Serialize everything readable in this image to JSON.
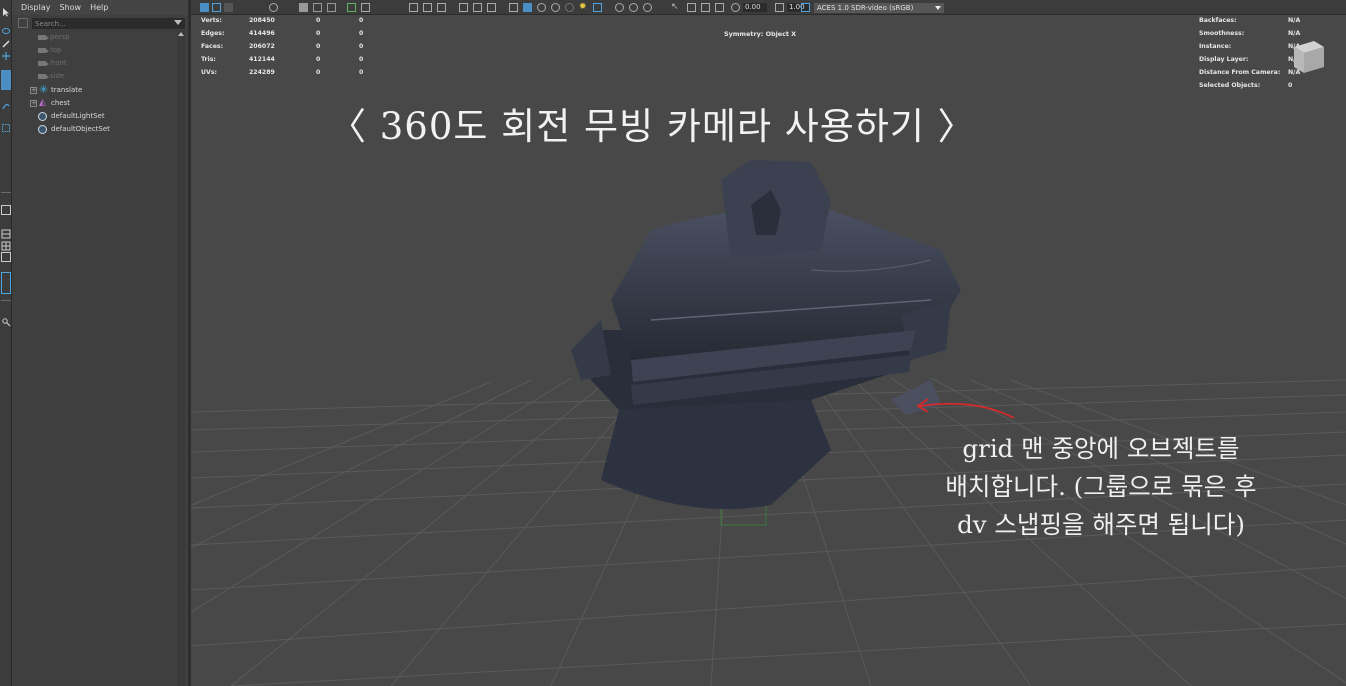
{
  "outliner": {
    "menu": [
      "Display",
      "Show",
      "Help"
    ],
    "search_placeholder": "Search...",
    "items": [
      {
        "label": "persp",
        "type": "camera",
        "dim": true
      },
      {
        "label": "top",
        "type": "camera",
        "dim": true
      },
      {
        "label": "front",
        "type": "camera",
        "dim": true
      },
      {
        "label": "side",
        "type": "camera",
        "dim": true
      },
      {
        "label": "translate",
        "type": "locator",
        "dim": false
      },
      {
        "label": "chest",
        "type": "mesh",
        "dim": false
      },
      {
        "label": "defaultLightSet",
        "type": "set",
        "dim": false
      },
      {
        "label": "defaultObjectSet",
        "type": "set",
        "dim": false
      }
    ]
  },
  "toolbar": {
    "exposure": "0.00",
    "gamma": "1.00",
    "color_space": "ACES 1.0 SDR-video (sRGB)"
  },
  "hud_left": {
    "labels": [
      "Verts:",
      "Edges:",
      "Faces:",
      "Tris:",
      "UVs:"
    ],
    "values": [
      "208450",
      "414496",
      "206072",
      "412144",
      "224289"
    ],
    "col2": [
      "0",
      "0",
      "0",
      "0",
      "0"
    ],
    "col3": [
      "0",
      "0",
      "0",
      "0",
      "0"
    ]
  },
  "hud_center": {
    "symmetry": "Symmetry: Object X"
  },
  "hud_right": {
    "labels": [
      "Backfaces:",
      "Smoothness:",
      "Instance:",
      "Display Layer:",
      "Distance From Camera:",
      "Selected Objects:"
    ],
    "values": [
      "N/A",
      "N/A",
      "N/A",
      "N/A",
      "N/A",
      "0"
    ]
  },
  "overlay": {
    "title": "〈 360도 회전 무빙 카메라 사용하기 〉",
    "annotation_lines": [
      "grid 맨 중앙에 오브젝트를",
      "배치합니다. (그룹으로 묶은 후",
      "dv 스냅핑을 해주면 됩니다)"
    ]
  },
  "colors": {
    "viewport_bg": "#484848",
    "grid_line": "#5a5a5a",
    "annotation_arrow": "#d42a2a",
    "model": "#343a48"
  }
}
